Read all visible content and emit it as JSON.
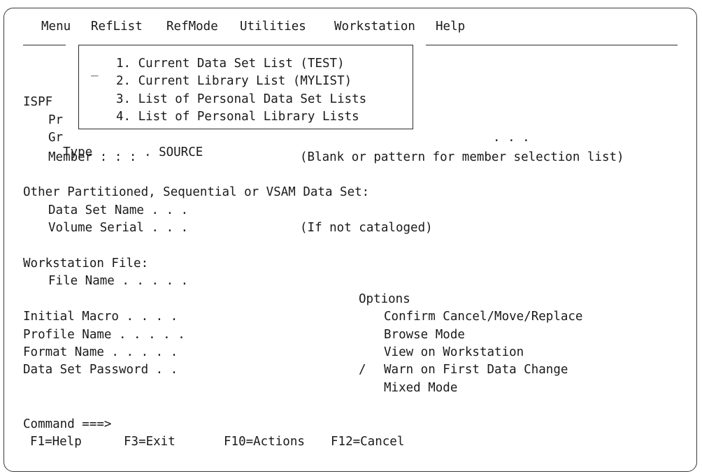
{
  "menubar": {
    "items": [
      "Menu",
      "RefList",
      "RefMode",
      "Utilities",
      "Workstation",
      "Help"
    ]
  },
  "popup": {
    "cursor": "_",
    "items": [
      "1. Current Data Set List (TEST)",
      "2. Current Library List (MYLIST)",
      "3. List of Personal Data Set Lists",
      "4. List of Personal Library Lists"
    ]
  },
  "ispf_library": {
    "header": "ISPF",
    "project_partial": "Pr",
    "group_partial": "Gr",
    "group_dots": ". . .",
    "type_label": "Type . . . .",
    "type_value": "SOURCE",
    "member_label": "Member . . .",
    "member_hint": "(Blank or pattern for member selection list)"
  },
  "other_dataset": {
    "header": "Other Partitioned, Sequential or VSAM Data Set:",
    "dsn_label": "Data Set Name . . .",
    "volume_label": "Volume Serial . . .",
    "volume_hint": "(If not cataloged)"
  },
  "workstation": {
    "header": "Workstation File:",
    "file_label": "File Name . . . . ."
  },
  "fields": {
    "initial_macro": "Initial Macro . . . .",
    "profile_name": "Profile Name . . . . .",
    "format_name": "Format Name . . . . .",
    "password": "Data Set Password . ."
  },
  "options": {
    "header": "Options",
    "items": [
      {
        "mark": "",
        "label": "Confirm Cancel/Move/Replace"
      },
      {
        "mark": "",
        "label": "Browse Mode"
      },
      {
        "mark": "",
        "label": "View on Workstation"
      },
      {
        "mark": "/",
        "label": "Warn on First Data Change"
      },
      {
        "mark": "",
        "label": "Mixed Mode"
      }
    ]
  },
  "command": {
    "label": "Command ===>"
  },
  "fkeys": [
    "F1=Help",
    "F3=Exit",
    "F10=Actions",
    "F12=Cancel"
  ],
  "colors": {
    "text": "#1a1a1a",
    "border": "#2b2b2b",
    "background": "#ffffff"
  }
}
